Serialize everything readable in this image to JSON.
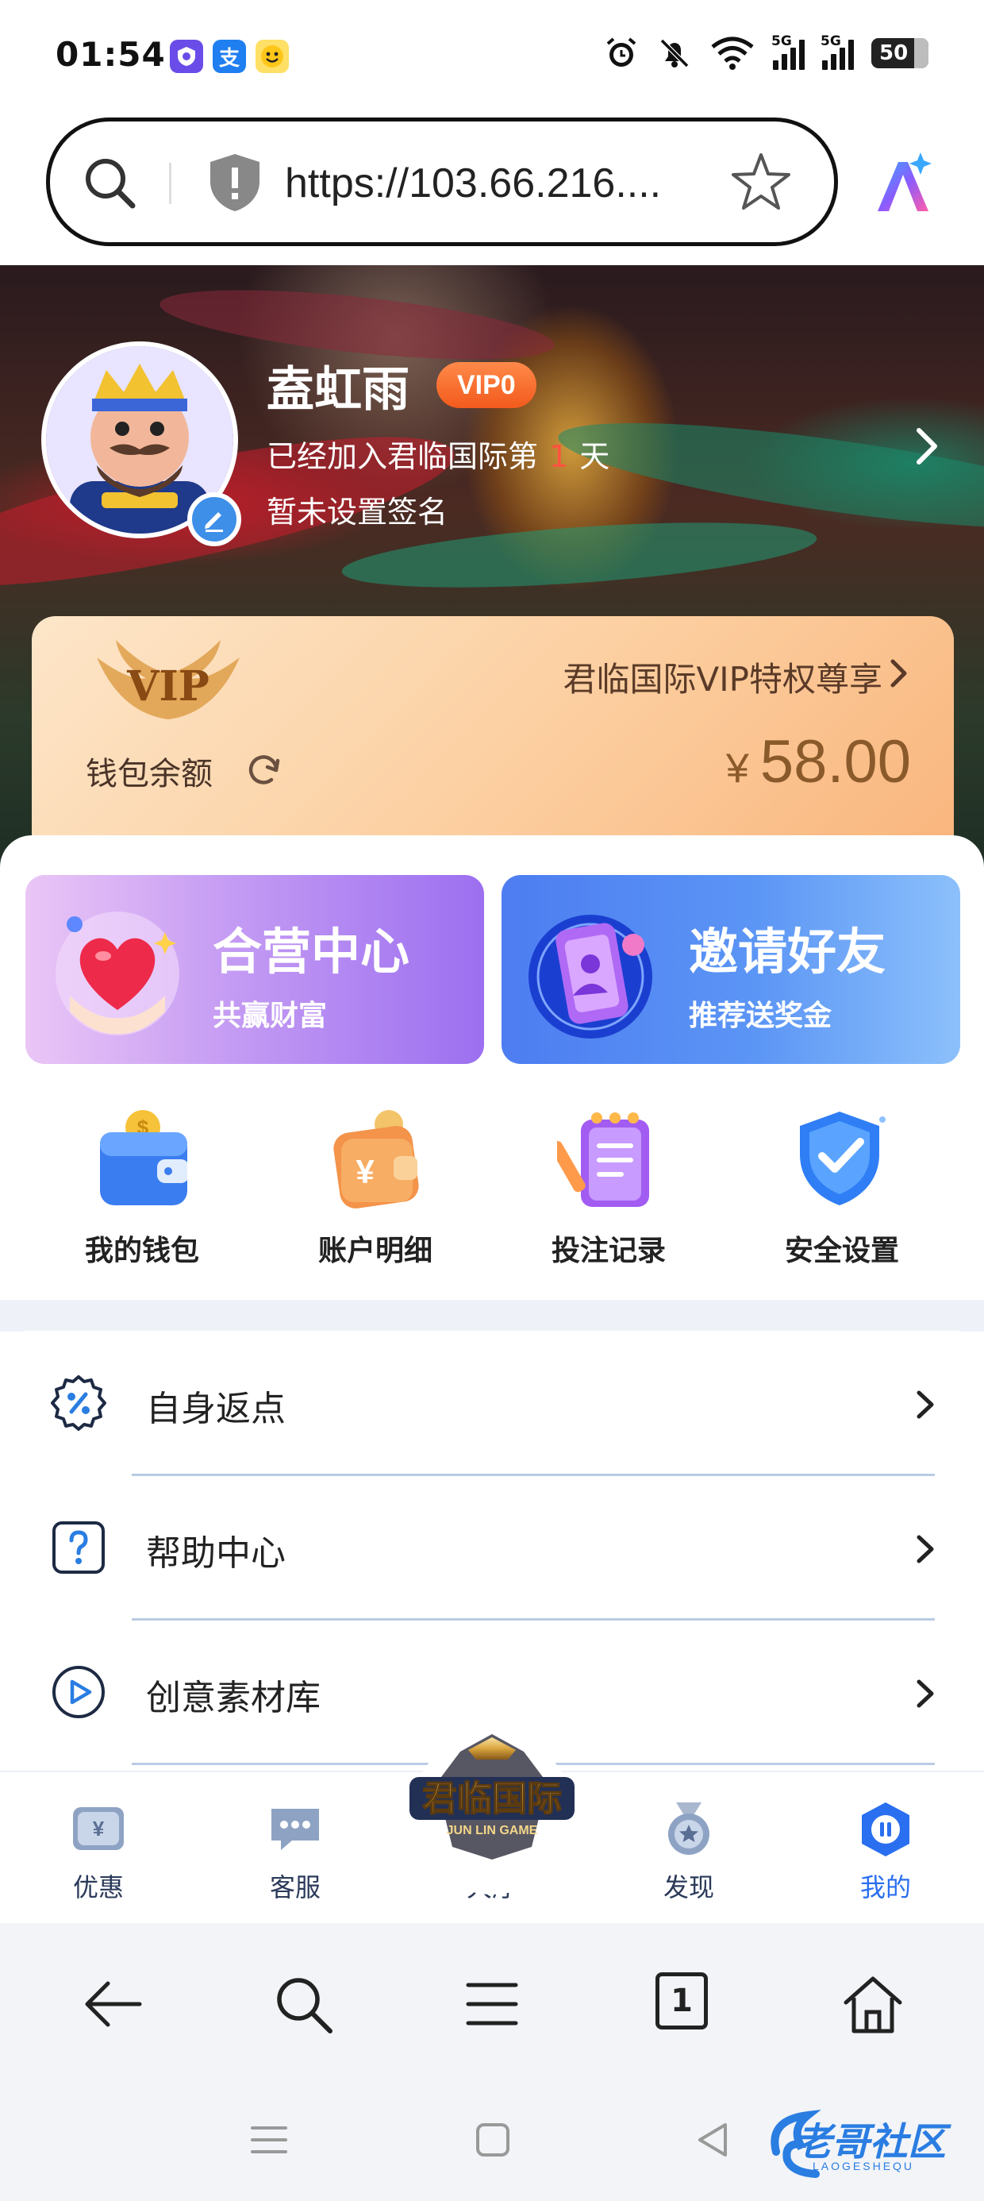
{
  "status_bar": {
    "time": "01:54",
    "app_icons": [
      {
        "name": "shield-app-icon",
        "color": "#6a4de8",
        "glyph": "⬢"
      },
      {
        "name": "alipay-app-icon",
        "color": "#1f7ef0",
        "glyph": "支"
      },
      {
        "name": "emoji-app-icon",
        "color": "#ffd23a",
        "glyph": "☺"
      }
    ],
    "network_label": "5G",
    "battery": "50"
  },
  "browser": {
    "url": "https://103.66.216....",
    "tab_count": "1"
  },
  "profile": {
    "name": "盍虹雨",
    "vip_level": "VIP0",
    "join_prefix": "已经加入君临国际第",
    "join_days": "1",
    "join_suffix": "天",
    "signature": "暂未设置签名"
  },
  "wallet": {
    "vip_logo_text": "VIP",
    "privilege_text": "君临国际VIP特权尊享",
    "balance_label": "钱包余额",
    "currency": "¥",
    "balance": "58.00"
  },
  "promos": [
    {
      "title": "合营中心",
      "subtitle": "共赢财富"
    },
    {
      "title": "邀请好友",
      "subtitle": "推荐送奖金"
    }
  ],
  "quick_actions": [
    {
      "label": "我的钱包",
      "icon": "wallet-icon"
    },
    {
      "label": "账户明细",
      "icon": "account-details-icon"
    },
    {
      "label": "投注记录",
      "icon": "bet-record-icon"
    },
    {
      "label": "安全设置",
      "icon": "security-shield-icon"
    }
  ],
  "menu": [
    {
      "label": "自身返点",
      "icon": "rebate-percent-icon"
    },
    {
      "label": "帮助中心",
      "icon": "help-question-icon"
    },
    {
      "label": "创意素材库",
      "icon": "media-play-icon"
    }
  ],
  "tabs": [
    {
      "label": "优惠",
      "icon": "offers-icon"
    },
    {
      "label": "客服",
      "icon": "customer-service-icon"
    },
    {
      "label": "大厅",
      "icon": "hall-logo-icon",
      "logo_text": "君临国际",
      "logo_sub": "JUN LIN GAME"
    },
    {
      "label": "发现",
      "icon": "discover-medal-icon"
    },
    {
      "label": "我的",
      "icon": "profile-icon",
      "active": true
    }
  ],
  "watermark": {
    "text": "老哥社区",
    "sub": "LAOGESHEQU"
  },
  "colors": {
    "accent_blue": "#2a6ff0",
    "vip_orange": "#f25a1c",
    "balance_brown": "#8b5a2b",
    "join_days_red": "#ff5340"
  }
}
